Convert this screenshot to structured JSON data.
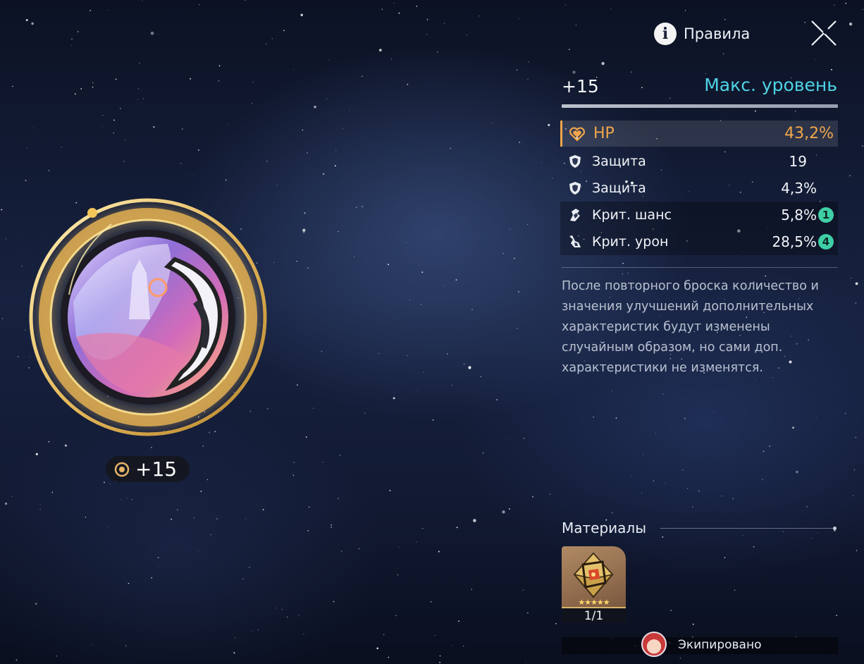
{
  "header": {
    "rules_label": "Правила",
    "icons": {
      "info": "info-icon",
      "close": "close-icon"
    }
  },
  "level": {
    "current": "+15",
    "max_label": "Макс. уровень"
  },
  "stats": {
    "main": {
      "name": "HP",
      "value": "43,2%",
      "icon": "heart-icon"
    },
    "sub": [
      {
        "name": "Защита",
        "value": "19",
        "icon": "shield-icon",
        "upgrades": null
      },
      {
        "name": "Защита",
        "value": "4,3%",
        "icon": "shield-icon",
        "upgrades": null
      },
      {
        "name": "Крит. шанс",
        "value": "5,8%",
        "icon": "crit-rate-icon",
        "upgrades": "1"
      },
      {
        "name": "Крит. урон",
        "value": "28,5%",
        "icon": "crit-damage-icon",
        "upgrades": "4"
      }
    ]
  },
  "description": "После повторного броска количество и значения улучшений дополнительных характеристик будут изменены случайным образом, но сами доп. характеристики не изменятся.",
  "materials": {
    "title": "Материалы",
    "items": [
      {
        "icon": "octahedron-crystal-icon",
        "count": "1/1",
        "stars": 5
      }
    ]
  },
  "equipped": {
    "label": "Экипировано",
    "avatar": "character-avatar"
  },
  "item": {
    "level": "+15",
    "ring_icon": "enhance-ring-icon"
  },
  "colors": {
    "accent_cyan": "#4fd3e6",
    "main_stat_orange": "#f0a64a",
    "upgrade_badge": "#3fcfa6",
    "gold_ring": "#e8c46a"
  }
}
